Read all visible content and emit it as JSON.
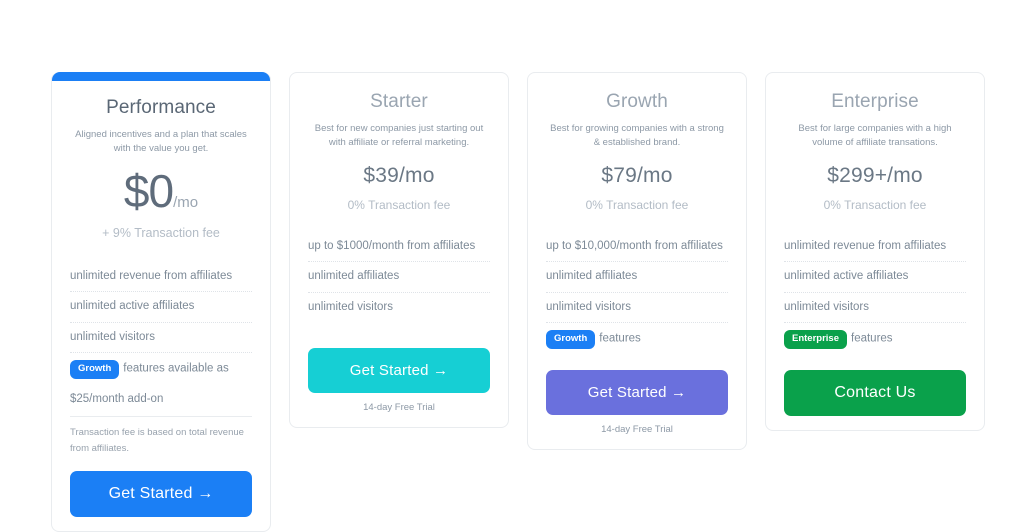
{
  "plans": [
    {
      "id": "performance",
      "featured": true,
      "accent_color": "#1b7ff5",
      "name": "Performance",
      "description": "Aligned incentives and a plan that scales with the value you get.",
      "price_main": "$0",
      "price_suffix": "/mo",
      "fee_note": "+ 9% Transaction fee",
      "features": [
        "unlimited revenue from affiliates",
        "unlimited active affiliates",
        "unlimited visitors"
      ],
      "badge": {
        "label": "Growth",
        "color": "blue",
        "text": "features available as"
      },
      "addon_line": "$25/month add-on",
      "fine_print": "Transaction fee is based on total revenue from affiliates.",
      "cta_label": "Get Started  →",
      "cta_color": "blue",
      "trial": ""
    },
    {
      "id": "starter",
      "featured": false,
      "name": "Starter",
      "description": "Best for new companies just starting out with affiliate or referral marketing.",
      "price_main": "$39/mo",
      "price_suffix": "",
      "fee_note": "0% Transaction fee",
      "features": [
        "up to $1000/month from affiliates",
        "unlimited affiliates",
        "unlimited visitors"
      ],
      "badge": null,
      "addon_line": "",
      "fine_print": "",
      "cta_label": "Get Started  →",
      "cta_color": "cyan",
      "trial": "14-day Free Trial"
    },
    {
      "id": "growth",
      "featured": false,
      "name": "Growth",
      "description": "Best for growing companies with a strong & established brand.",
      "price_main": "$79/mo",
      "price_suffix": "",
      "fee_note": "0% Transaction fee",
      "features": [
        "up to $10,000/month from affiliates",
        "unlimited affiliates",
        "unlimited visitors"
      ],
      "badge": {
        "label": "Growth",
        "color": "blue",
        "text": "features"
      },
      "addon_line": "",
      "fine_print": "",
      "cta_label": "Get Started  →",
      "cta_color": "purple",
      "trial": "14-day Free Trial"
    },
    {
      "id": "enterprise",
      "featured": false,
      "name": "Enterprise",
      "description": "Best for large companies with a high volume of affiliate transations.",
      "price_main": "$299+/mo",
      "price_suffix": "",
      "fee_note": "0% Transaction fee",
      "features": [
        "unlimited revenue from affiliates",
        "unlimited active affiliates",
        "unlimited visitors"
      ],
      "badge": {
        "label": "Enterprise",
        "color": "green",
        "text": "features"
      },
      "addon_line": "",
      "fine_print": "",
      "cta_label": "Contact Us",
      "cta_color": "green",
      "trial": ""
    }
  ]
}
